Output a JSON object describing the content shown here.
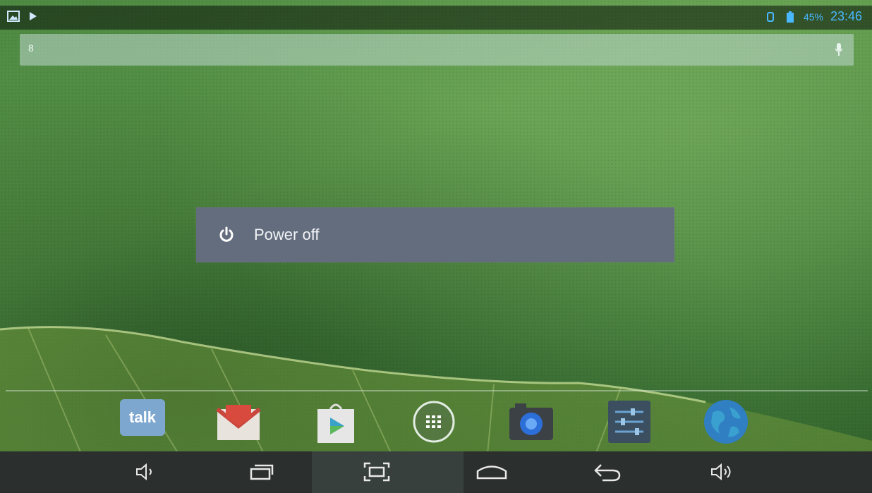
{
  "status_bar": {
    "notification_icons": [
      "gallery-icon",
      "play-icon"
    ],
    "battery_percent": "45%",
    "time": "23:46",
    "accent_color": "#49b8ff"
  },
  "search": {
    "hint": "8"
  },
  "power_dialog": {
    "label": "Power off"
  },
  "dock": {
    "apps": [
      {
        "name": "talk",
        "label": "talk"
      },
      {
        "name": "gmail"
      },
      {
        "name": "play-store"
      },
      {
        "name": "app-drawer"
      },
      {
        "name": "camera"
      },
      {
        "name": "settings"
      },
      {
        "name": "browser"
      }
    ]
  },
  "nav_bar": {
    "buttons": [
      "volume-down",
      "recent-apps",
      "screenshot",
      "home",
      "back",
      "volume-up"
    ]
  }
}
